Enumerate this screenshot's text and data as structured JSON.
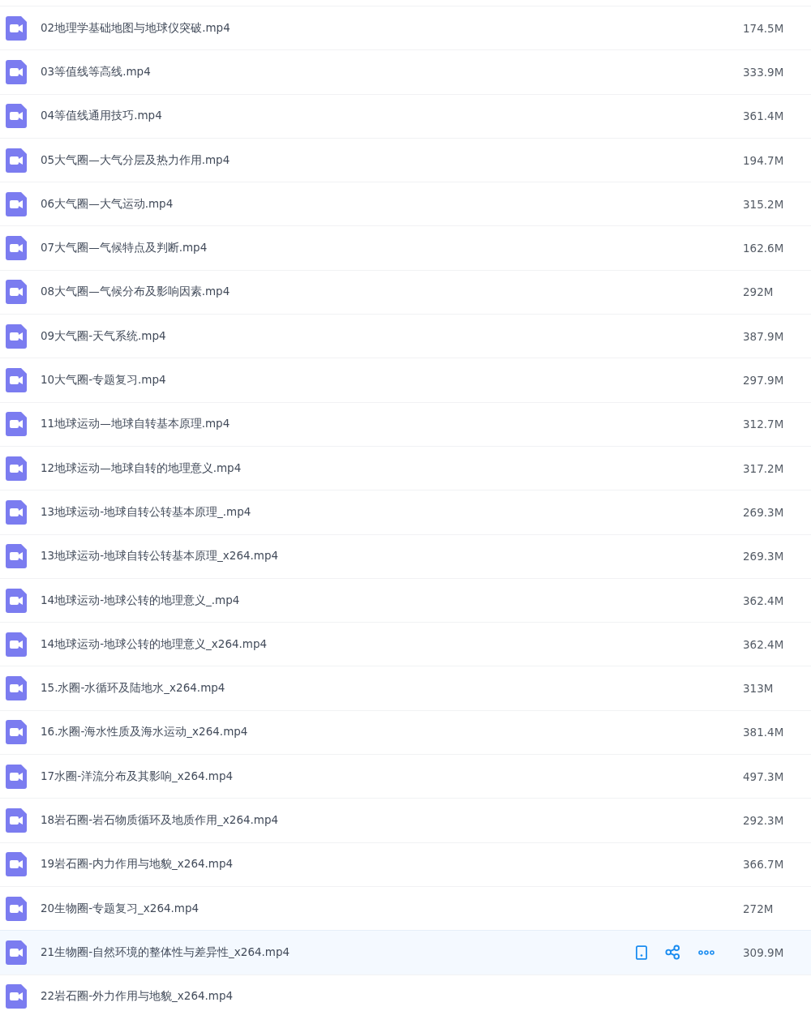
{
  "files": [
    {
      "name": "02地理学基础地图与地球仪突破.mp4",
      "size": "174.5M",
      "selected": false
    },
    {
      "name": "03等值线等高线.mp4",
      "size": "333.9M",
      "selected": false
    },
    {
      "name": "04等值线通用技巧.mp4",
      "size": "361.4M",
      "selected": false
    },
    {
      "name": "05大气圈—大气分层及热力作用.mp4",
      "size": "194.7M",
      "selected": false
    },
    {
      "name": "06大气圈—大气运动.mp4",
      "size": "315.2M",
      "selected": false
    },
    {
      "name": "07大气圈—气候特点及判断.mp4",
      "size": "162.6M",
      "selected": false
    },
    {
      "name": "08大气圈—气候分布及影响因素.mp4",
      "size": "292M",
      "selected": false
    },
    {
      "name": "09大气圈-天气系统.mp4",
      "size": "387.9M",
      "selected": false
    },
    {
      "name": "10大气圈-专题复习.mp4",
      "size": "297.9M",
      "selected": false
    },
    {
      "name": "11地球运动—地球自转基本原理.mp4",
      "size": "312.7M",
      "selected": false
    },
    {
      "name": "12地球运动—地球自转的地理意义.mp4",
      "size": "317.2M",
      "selected": false
    },
    {
      "name": "13地球运动-地球自转公转基本原理_.mp4",
      "size": "269.3M",
      "selected": false
    },
    {
      "name": "13地球运动-地球自转公转基本原理_x264.mp4",
      "size": "269.3M",
      "selected": false
    },
    {
      "name": "14地球运动-地球公转的地理意义_.mp4",
      "size": "362.4M",
      "selected": false
    },
    {
      "name": "14地球运动-地球公转的地理意义_x264.mp4",
      "size": "362.4M",
      "selected": false
    },
    {
      "name": "15.水圈-水循环及陆地水_x264.mp4",
      "size": "313M",
      "selected": false
    },
    {
      "name": "16.水圈-海水性质及海水运动_x264.mp4",
      "size": "381.4M",
      "selected": false
    },
    {
      "name": "17水圈-洋流分布及其影响_x264.mp4",
      "size": "497.3M",
      "selected": false
    },
    {
      "name": "18岩石圈-岩石物质循环及地质作用_x264.mp4",
      "size": "292.3M",
      "selected": false
    },
    {
      "name": "19岩石圈-内力作用与地貌_x264.mp4",
      "size": "366.7M",
      "selected": false
    },
    {
      "name": "20生物圈-专题复习_x264.mp4",
      "size": "272M",
      "selected": false
    },
    {
      "name": "21生物圈-自然环境的整体性与差异性_x264.mp4",
      "size": "309.9M",
      "selected": true
    },
    {
      "name": "22岩石圈-外力作用与地貌_x264.mp4",
      "selected": false
    }
  ]
}
